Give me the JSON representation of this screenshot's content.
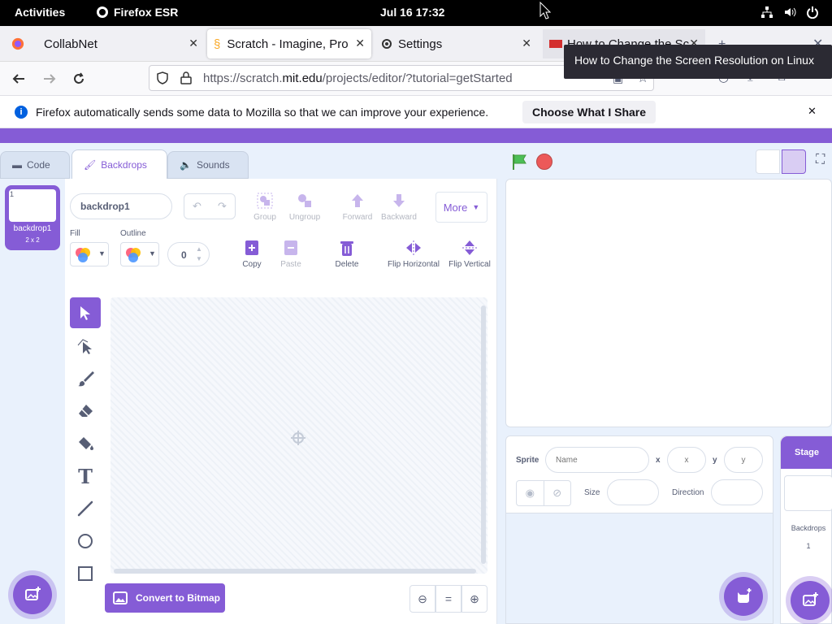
{
  "topbar": {
    "activities": "Activities",
    "app": "Firefox ESR",
    "clock": "Jul 16  17:32"
  },
  "tabs": [
    {
      "label": "CollabNet"
    },
    {
      "label": "Scratch - Imagine, Prog"
    },
    {
      "label": "Settings"
    },
    {
      "label": "How to Change the Sc"
    }
  ],
  "nav": {
    "url_prefix": "https://scratch.",
    "url_domain": "mit.edu",
    "url_rest": "/projects/editor/?tutorial=getStarted"
  },
  "tooltip": "How to Change the Screen Resolution on Linux",
  "notice": {
    "text": "Firefox automatically sends some data to Mozilla so that we can improve your experience.",
    "button": "Choose What I Share"
  },
  "editor_tabs": {
    "code": "Code",
    "backdrops": "Backdrops",
    "sounds": "Sounds"
  },
  "costume": {
    "index": "1",
    "name": "backdrop1",
    "size": "2 x 2"
  },
  "paint": {
    "name_value": "backdrop1",
    "fill_label": "Fill",
    "outline_label": "Outline",
    "outline_width": "0",
    "group": "Group",
    "ungroup": "Ungroup",
    "forward": "Forward",
    "backward": "Backward",
    "more": "More",
    "copy": "Copy",
    "paste": "Paste",
    "delete": "Delete",
    "flip_h": "Flip Horizontal",
    "flip_v": "Flip Vertical",
    "convert": "Convert to Bitmap"
  },
  "sprite_info": {
    "sprite_label": "Sprite",
    "name_placeholder": "Name",
    "x_label": "x",
    "x_placeholder": "x",
    "y_label": "y",
    "y_placeholder": "y",
    "size_label": "Size",
    "direction_label": "Direction"
  },
  "stage_panel": {
    "title": "Stage",
    "backdrops_label": "Backdrops",
    "backdrops_count": "1"
  },
  "colors": {
    "accent": "#855cd6",
    "bg": "#e9f1fc",
    "flag": "#4cbf56",
    "stop": "#ec5959"
  }
}
